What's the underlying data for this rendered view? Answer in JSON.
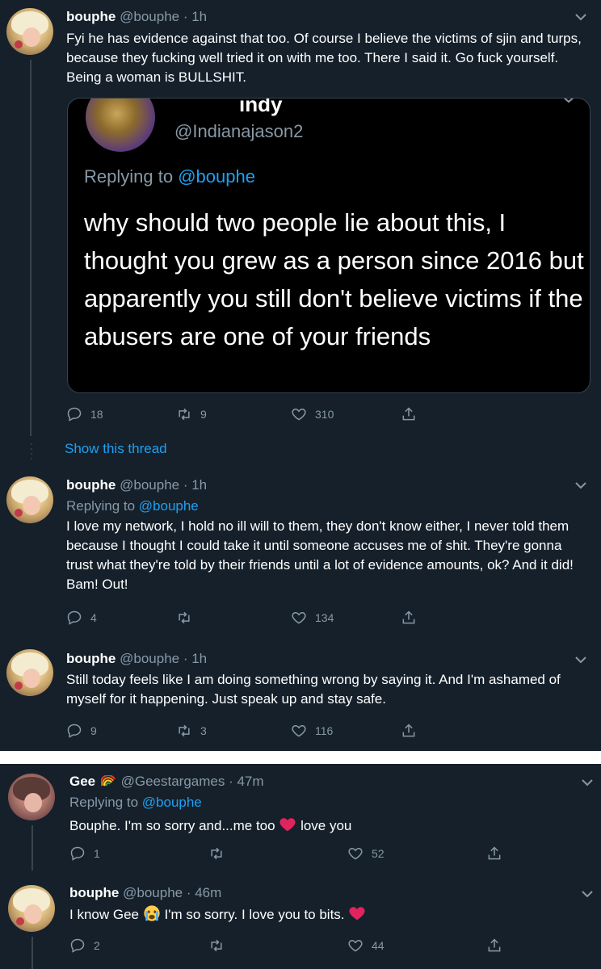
{
  "colors": {
    "background": "#15202b",
    "text": "#ffffff",
    "muted": "#8899a6",
    "accent": "#1da1f2",
    "divider": "#ffffff"
  },
  "tweet1": {
    "name": "bouphe",
    "meta": "@bouphe · 1h",
    "text": "Fyi he has evidence against that too. Of course I believe the victims of sjin and turps, because they fucking well tried it on with me too. There I said it. Go fuck yourself. Being a woman is BULLSHIT.",
    "quoted": {
      "name": "indy",
      "handle": "@Indianajason2",
      "replying_prefix": "Replying to ",
      "replying_handle": "@bouphe",
      "text": "why should two people lie about this, I thought you grew as a person since 2016 but apparently you still don't believe victims if the abusers are one of your friends"
    },
    "replies": "18",
    "retweets": "9",
    "likes": "310",
    "show_thread": "Show this thread"
  },
  "tweet2": {
    "name": "bouphe",
    "meta": "@bouphe · 1h",
    "replying_prefix": "Replying to ",
    "replying_handle": "@bouphe",
    "text": "I love my network, I hold no ill will to them, they don't know either, I never told them because I thought I could take it until someone accuses me of shit. They're gonna trust what they're told by their friends until a lot of evidence amounts, ok? And it did! Bam! Out!",
    "replies": "4",
    "retweets": "",
    "likes": "134"
  },
  "tweet3": {
    "name": "bouphe",
    "meta": "@bouphe · 1h",
    "text": "Still today feels like I am doing something wrong by saying it. And I'm ashamed of myself for it happening. Just speak up and stay safe.",
    "replies": "9",
    "retweets": "3",
    "likes": "116"
  },
  "tweet4": {
    "name": "Gee",
    "emoji_icon": "rainbow-icon",
    "meta": "@Geestargames · 47m",
    "replying_prefix": "Replying to ",
    "replying_handle": "@bouphe",
    "text_before": "Bouphe. I'm so sorry and...me too",
    "emoji_mid_icon": "red-heart-icon",
    "text_after": "love you",
    "replies": "1",
    "retweets": "",
    "likes": "52"
  },
  "tweet5": {
    "name": "bouphe",
    "meta": "@bouphe · 46m",
    "text_before": "I know Gee",
    "emoji_mid_icon": "crying-face-icon",
    "text_after": "I'm so sorry. I love you to bits.",
    "emoji_end_icon": "red-heart-icon",
    "replies": "2",
    "retweets": "",
    "likes": "44"
  }
}
